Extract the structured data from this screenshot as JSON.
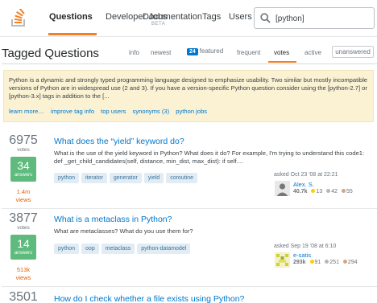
{
  "nav": {
    "items": [
      {
        "label": "Questions"
      },
      {
        "label": "Developer Jobs"
      },
      {
        "label": "Documentation"
      },
      {
        "label": "Tags"
      },
      {
        "label": "Users"
      }
    ],
    "beta_label": "BETA",
    "accent": "#f48024"
  },
  "search": {
    "value": "[python]"
  },
  "header": {
    "title": "Tagged Questions",
    "tabs": [
      {
        "label": "info"
      },
      {
        "label": "newest"
      },
      {
        "label": "featured",
        "badge": "24"
      },
      {
        "label": "frequent"
      },
      {
        "label": "votes"
      },
      {
        "label": "active"
      },
      {
        "label": "unanswered"
      }
    ],
    "active_tab": "votes"
  },
  "tag_wiki": {
    "text": "Python is a dynamic and strongly typed programming language designed to emphasize usability. Two similar but mostly incompatible versions of Python are in widespread use (2 and 3). If you have a version-specific Python question consider using the [python-2.7] or [python-3.x] tags in addition to the [...",
    "links": [
      "learn more…",
      "improve tag info",
      "top users",
      "synonyms (3)",
      "python jobs"
    ]
  },
  "questions": [
    {
      "votes": "6975",
      "votes_label": "votes",
      "answers": "34",
      "answers_label": "answers",
      "views": "1.4m",
      "views_label": "views",
      "title": "What does the “yield” keyword do?",
      "excerpt": "What is the use of the yield keyword in Python? What does it do? For example, I'm trying to understand this code1: def _get_child_candidates(self, distance, min_dist, max_dist): if self....",
      "tags": [
        "python",
        "iterator",
        "generator",
        "yield",
        "coroutine"
      ],
      "asked": "asked Oct 23 '08 at 22:21",
      "user": {
        "name": "Alex. S.",
        "rep": "40.7k",
        "gold": "13",
        "silver": "42",
        "bronze": "55"
      }
    },
    {
      "votes": "3877",
      "votes_label": "votes",
      "answers": "14",
      "answers_label": "answers",
      "views": "513k",
      "views_label": "views",
      "title": "What is a metaclass in Python?",
      "excerpt": "What are metaclasses? What do you use them for?",
      "tags": [
        "python",
        "oop",
        "metaclass",
        "python-datamodel"
      ],
      "asked": "asked Sep 19 '08 at 6:10",
      "user": {
        "name": "e-satis",
        "rep": "293k",
        "gold": "91",
        "silver": "251",
        "bronze": "294"
      }
    },
    {
      "votes": "3501",
      "title": "How do I check whether a file exists using Python?"
    }
  ]
}
